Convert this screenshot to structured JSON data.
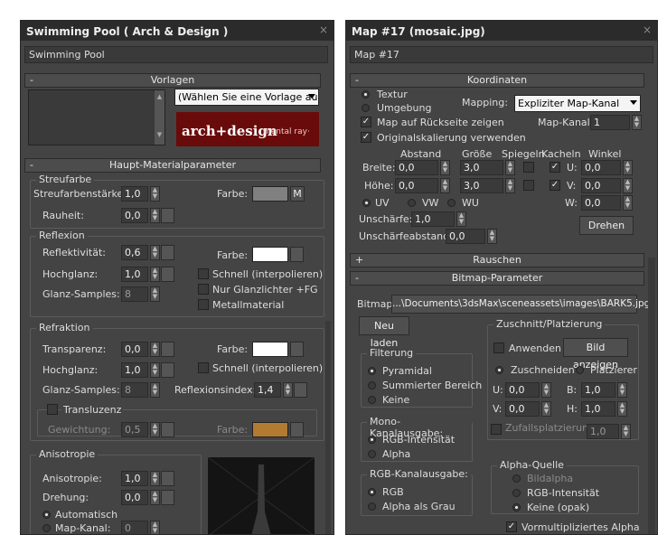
{
  "left": {
    "title": "Swimming Pool  ( Arch & Design )",
    "material_name": "Swimming Pool",
    "templates": {
      "header": "Vorlagen",
      "dropdown": "(Wählen Sie eine Vorlage aus",
      "logo_main": "arch+design",
      "logo_sub": "mental ray·"
    },
    "main": {
      "header": "Haupt-Materialparameter",
      "diffuse": {
        "label": "Streufarbe",
        "weight_label": "Streufarbenstärke:",
        "weight": "1,0",
        "color_label": "Farbe:",
        "m": "M",
        "rough_label": "Rauheit:",
        "rough": "0,0"
      },
      "reflection": {
        "label": "Reflexion",
        "refl_label": "Reflektivität:",
        "refl": "0,6",
        "color_label": "Farbe:",
        "gloss_label": "Hochglanz:",
        "gloss": "1,0",
        "fast": "Schnell (interpolieren)",
        "samples_label": "Glanz-Samples:",
        "samples": "8",
        "highlights": "Nur Glanzlichter +FG",
        "metal": "Metallmaterial"
      },
      "refraction": {
        "label": "Refraktion",
        "trans_label": "Transparenz:",
        "trans": "0,0",
        "color_label": "Farbe:",
        "gloss_label": "Hochglanz:",
        "gloss": "1,0",
        "fast": "Schnell (interpolieren)",
        "samples_label": "Glanz-Samples:",
        "samples": "8",
        "ior_label": "Reflexionsindex:",
        "ior": "1,4"
      },
      "translucency": {
        "label": "Transluzenz",
        "weight_label": "Gewichtung:",
        "weight": "0,5",
        "color_label": "Farbe:"
      },
      "aniso": {
        "label": "Anisotropie",
        "aniso_label": "Anisotropie:",
        "aniso": "1,0",
        "rot_label": "Drehung:",
        "rot": "0,0",
        "auto": "Automatisch",
        "map_label": "Map-Kanal:",
        "map": "0"
      }
    }
  },
  "right": {
    "title": "Map #17 (mosaic.jpg)",
    "map_name": "Map #17",
    "coords": {
      "header": "Koordinaten",
      "texture": "Textur",
      "environ": "Umgebung",
      "mapping_label": "Mapping:",
      "mapping": "Expliziter Map-Kanal",
      "backside": "Map auf Rückseite zeigen",
      "channel_label": "Map-Kanal:",
      "channel": "1",
      "real_scale": "Originalskalierung verwenden",
      "col_offset": "Abstand",
      "col_size": "Größe",
      "col_mirror": "Spiegeln",
      "col_tile": "Kacheln",
      "col_angle": "Winkel",
      "width_label": "Breite:",
      "width_off": "0,0",
      "width_size": "3,0",
      "u_label": "U:",
      "u_angle": "0,0",
      "height_label": "Höhe:",
      "height_off": "0,0",
      "height_size": "3,0",
      "v_label": "V:",
      "v_angle": "0,0",
      "uv": "UV",
      "vw": "VW",
      "wu": "WU",
      "w_label": "W:",
      "w_angle": "0,0",
      "blur_label": "Unschärfe:",
      "blur": "1,0",
      "blur_off_label": "Unschärfeabstand:",
      "blur_off": "0,0",
      "rotate": "Drehen"
    },
    "noise": {
      "header": "Rauschen"
    },
    "bitmap": {
      "header": "Bitmap-Parameter",
      "path_label": "Bitmap:",
      "path": "...\\Documents\\3dsMax\\sceneassets\\images\\BARK5.jpg",
      "reload": "Neu laden",
      "filter": {
        "label": "Filterung",
        "pyramidal": "Pyramidal",
        "summed": "Summierter Bereich",
        "none": "Keine"
      },
      "crop": {
        "label": "Zuschnitt/Platzierung",
        "apply": "Anwenden",
        "view": "Bild anzeigen",
        "crop": "Zuschneiden",
        "place": "Platzierer",
        "u_label": "U:",
        "u": "0,0",
        "w_label": "B:",
        "w": "1,0",
        "v_label": "V:",
        "v": "0,0",
        "h_label": "H:",
        "h": "1,0",
        "jitter": "Zufallsplatzierung:",
        "jitter_val": "1,0"
      },
      "mono": {
        "label": "Mono-Kanalausgabe:",
        "rgb_int": "RGB-Intensität",
        "alpha": "Alpha"
      },
      "rgb_out": {
        "label": "RGB-Kanalausgabe:",
        "rgb": "RGB",
        "alpha_gray": "Alpha als Grau"
      },
      "alpha_src": {
        "label": "Alpha-Quelle",
        "img_alpha": "Bildalpha",
        "rgb_int": "RGB-Intensität",
        "none": "Keine (opak)"
      },
      "premult": "Vormultipliziertes Alpha"
    }
  }
}
